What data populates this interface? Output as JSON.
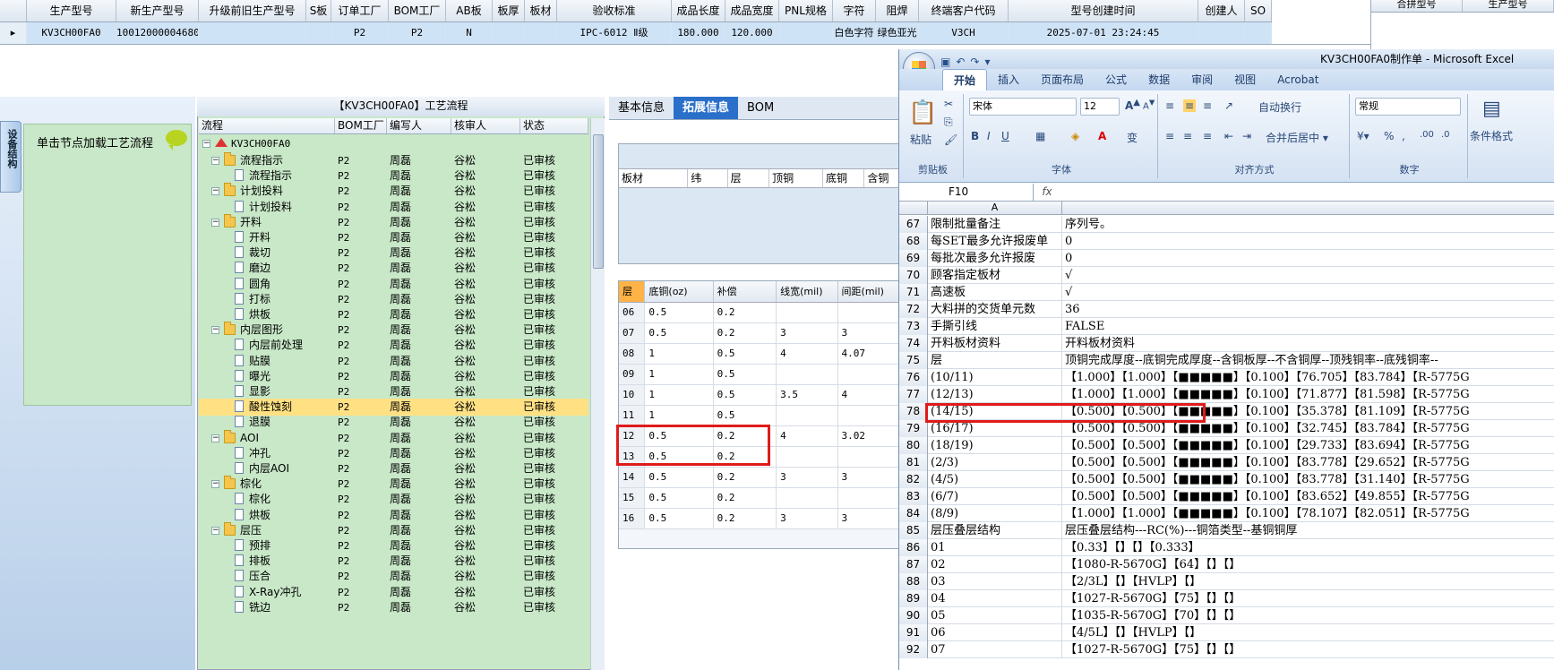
{
  "top_grid": {
    "headers": [
      "生产型号",
      "新生产型号",
      "升级前旧生产型号",
      "S板",
      "订单工厂",
      "BOM工厂",
      "AB板",
      "板厚",
      "板材",
      "验收标准",
      "成品长度",
      "成品宽度",
      "PNL规格",
      "字符",
      "阻焊",
      "终端客户代码",
      "型号创建时间",
      "创建人",
      "SO"
    ],
    "row": [
      "KV3CH00FA0",
      "10012000004680",
      "",
      "",
      "P2",
      "P2",
      "N",
      "",
      "",
      "IPC-6012 Ⅱ级",
      "180.000",
      "120.000",
      "",
      "白色字符",
      "绿色亚光",
      "V3CH",
      "2025-07-01 23:24:45",
      "",
      ""
    ],
    "row_indicator": "▸"
  },
  "merge_panel": {
    "headers": [
      "合拼型号",
      "生产型号"
    ]
  },
  "left_panel": {
    "vertical_tab": "设备结构",
    "load_label": "单击节点加载工艺流程"
  },
  "tree": {
    "title": "【KV3CH00FA0】工艺流程",
    "headers": [
      "流程",
      "BOM工厂",
      "编写人",
      "核审人",
      "状态"
    ],
    "root": "KV3CH00FA0",
    "rows": [
      {
        "label": "流程指示",
        "type": "folder",
        "level": 1,
        "bom": "P2",
        "writer": "周磊",
        "reviewer": "谷松",
        "status": "已审核"
      },
      {
        "label": "流程指示",
        "type": "file",
        "level": 2,
        "bom": "P2",
        "writer": "周磊",
        "reviewer": "谷松",
        "status": "已审核"
      },
      {
        "label": "计划投料",
        "type": "folder",
        "level": 1,
        "bom": "P2",
        "writer": "周磊",
        "reviewer": "谷松",
        "status": "已审核"
      },
      {
        "label": "计划投料",
        "type": "file",
        "level": 2,
        "bom": "P2",
        "writer": "周磊",
        "reviewer": "谷松",
        "status": "已审核"
      },
      {
        "label": "开料",
        "type": "folder",
        "level": 1,
        "bom": "P2",
        "writer": "周磊",
        "reviewer": "谷松",
        "status": "已审核"
      },
      {
        "label": "开料",
        "type": "file",
        "level": 2,
        "bom": "P2",
        "writer": "周磊",
        "reviewer": "谷松",
        "status": "已审核"
      },
      {
        "label": "裁切",
        "type": "file",
        "level": 2,
        "bom": "P2",
        "writer": "周磊",
        "reviewer": "谷松",
        "status": "已审核"
      },
      {
        "label": "磨边",
        "type": "file",
        "level": 2,
        "bom": "P2",
        "writer": "周磊",
        "reviewer": "谷松",
        "status": "已审核"
      },
      {
        "label": "圆角",
        "type": "file",
        "level": 2,
        "bom": "P2",
        "writer": "周磊",
        "reviewer": "谷松",
        "status": "已审核"
      },
      {
        "label": "打标",
        "type": "file",
        "level": 2,
        "bom": "P2",
        "writer": "周磊",
        "reviewer": "谷松",
        "status": "已审核"
      },
      {
        "label": "烘板",
        "type": "file",
        "level": 2,
        "bom": "P2",
        "writer": "周磊",
        "reviewer": "谷松",
        "status": "已审核"
      },
      {
        "label": "内层图形",
        "type": "folder",
        "level": 1,
        "bom": "P2",
        "writer": "周磊",
        "reviewer": "谷松",
        "status": "已审核"
      },
      {
        "label": "内层前处理",
        "type": "file",
        "level": 2,
        "bom": "P2",
        "writer": "周磊",
        "reviewer": "谷松",
        "status": "已审核"
      },
      {
        "label": "贴膜",
        "type": "file",
        "level": 2,
        "bom": "P2",
        "writer": "周磊",
        "reviewer": "谷松",
        "status": "已审核"
      },
      {
        "label": "曝光",
        "type": "file",
        "level": 2,
        "bom": "P2",
        "writer": "周磊",
        "reviewer": "谷松",
        "status": "已审核"
      },
      {
        "label": "显影",
        "type": "file",
        "level": 2,
        "bom": "P2",
        "writer": "周磊",
        "reviewer": "谷松",
        "status": "已审核"
      },
      {
        "label": "酸性蚀刻",
        "type": "file",
        "level": 2,
        "bom": "P2",
        "writer": "周磊",
        "reviewer": "谷松",
        "status": "已审核",
        "selected": true
      },
      {
        "label": "退膜",
        "type": "file",
        "level": 2,
        "bom": "P2",
        "writer": "周磊",
        "reviewer": "谷松",
        "status": "已审核"
      },
      {
        "label": "AOI",
        "type": "folder",
        "level": 1,
        "bom": "P2",
        "writer": "周磊",
        "reviewer": "谷松",
        "status": "已审核"
      },
      {
        "label": "冲孔",
        "type": "file",
        "level": 2,
        "bom": "P2",
        "writer": "周磊",
        "reviewer": "谷松",
        "status": "已审核"
      },
      {
        "label": "内层AOI",
        "type": "file",
        "level": 2,
        "bom": "P2",
        "writer": "周磊",
        "reviewer": "谷松",
        "status": "已审核"
      },
      {
        "label": "棕化",
        "type": "folder",
        "level": 1,
        "bom": "P2",
        "writer": "周磊",
        "reviewer": "谷松",
        "status": "已审核"
      },
      {
        "label": "棕化",
        "type": "file",
        "level": 2,
        "bom": "P2",
        "writer": "周磊",
        "reviewer": "谷松",
        "status": "已审核"
      },
      {
        "label": "烘板",
        "type": "file",
        "level": 2,
        "bom": "P2",
        "writer": "周磊",
        "reviewer": "谷松",
        "status": "已审核"
      },
      {
        "label": "层压",
        "type": "folder",
        "level": 1,
        "bom": "P2",
        "writer": "周磊",
        "reviewer": "谷松",
        "status": "已审核"
      },
      {
        "label": "预排",
        "type": "file",
        "level": 2,
        "bom": "P2",
        "writer": "周磊",
        "reviewer": "谷松",
        "status": "已审核"
      },
      {
        "label": "排板",
        "type": "file",
        "level": 2,
        "bom": "P2",
        "writer": "周磊",
        "reviewer": "谷松",
        "status": "已审核"
      },
      {
        "label": "压合",
        "type": "file",
        "level": 2,
        "bom": "P2",
        "writer": "周磊",
        "reviewer": "谷松",
        "status": "已审核"
      },
      {
        "label": "X-Ray冲孔",
        "type": "file",
        "level": 2,
        "bom": "P2",
        "writer": "周磊",
        "reviewer": "谷松",
        "status": "已审核"
      },
      {
        "label": "铣边",
        "type": "file",
        "level": 2,
        "bom": "P2",
        "writer": "周磊",
        "reviewer": "谷松",
        "status": "已审核"
      }
    ]
  },
  "mid_panel": {
    "tabs": [
      "基本信息",
      "拓展信息",
      "BOM"
    ],
    "active_tab": "拓展信息",
    "upper_headers": [
      "板材",
      "纬",
      "层",
      "顶铜",
      "底铜",
      "含铜"
    ],
    "lower_headers": [
      "层",
      "底铜(oz)",
      "补偿",
      "线宽(mil)",
      "间距(mil)"
    ],
    "lower_rows": [
      [
        "06",
        "0.5",
        "0.2",
        "",
        ""
      ],
      [
        "07",
        "0.5",
        "0.2",
        "3",
        "3"
      ],
      [
        "08",
        "1",
        "0.5",
        "4",
        "4.07"
      ],
      [
        "09",
        "1",
        "0.5",
        "",
        ""
      ],
      [
        "10",
        "1",
        "0.5",
        "3.5",
        "4"
      ],
      [
        "11",
        "1",
        "0.5",
        "",
        ""
      ],
      [
        "12",
        "0.5",
        "0.2",
        "4",
        "3.02"
      ],
      [
        "13",
        "0.5",
        "0.2",
        "",
        ""
      ],
      [
        "14",
        "0.5",
        "0.2",
        "3",
        "3"
      ],
      [
        "15",
        "0.5",
        "0.2",
        "",
        ""
      ],
      [
        "16",
        "0.5",
        "0.2",
        "3",
        "3"
      ]
    ]
  },
  "excel": {
    "title": "KV3CH00FA0制作单 - Microsoft Excel",
    "tabs": [
      "开始",
      "插入",
      "页面布局",
      "公式",
      "数据",
      "审阅",
      "视图",
      "Acrobat"
    ],
    "ribbon": {
      "paste": "粘贴",
      "clipboard": "剪贴板",
      "font_name": "宋体",
      "font_size": "12",
      "font_group": "字体",
      "wrap_text": "自动换行",
      "merge_center": "合并后居中",
      "align_group": "对齐方式",
      "number_format": "常规",
      "number_group": "数字",
      "cond_format": "条件格式"
    },
    "name_box": "F10",
    "fx": "fx",
    "col_a": "A",
    "rows": [
      {
        "n": "67",
        "a": "限制批量备注",
        "b": "序列号。"
      },
      {
        "n": "68",
        "a": "每SET最多允许报废单",
        "b": "0"
      },
      {
        "n": "69",
        "a": "每批次最多允许报废",
        "b": "0"
      },
      {
        "n": "70",
        "a": "顾客指定板材",
        "b": "√"
      },
      {
        "n": "71",
        "a": "高速板",
        "b": "√"
      },
      {
        "n": "72",
        "a": "大料拼的交货单元数",
        "b": "36"
      },
      {
        "n": "73",
        "a": "手撕引线",
        "b": "FALSE"
      },
      {
        "n": "74",
        "a": "开料板材资料",
        "b": "开料板材资料"
      },
      {
        "n": "75",
        "a": "层",
        "b": "顶铜完成厚度--底铜完成厚度--含铜板厚--不含铜厚--顶残铜率--底残铜率--"
      },
      {
        "n": "76",
        "a": "(10/11)",
        "b": "【1.000】【1.000】【■■■■■】【0.100】【76.705】【83.784】【R-5775G"
      },
      {
        "n": "77",
        "a": "(12/13)",
        "b": "【1.000】【1.000】【■■■■■】【0.100】【71.877】【81.598】【R-5775G"
      },
      {
        "n": "78",
        "a": "(14/15)",
        "b": "【0.500】【0.500】【■■■■■】【0.100】【35.378】【81.109】【R-5775G"
      },
      {
        "n": "79",
        "a": "(16/17)",
        "b": "【0.500】【0.500】【■■■■■】【0.100】【32.745】【83.784】【R-5775G"
      },
      {
        "n": "80",
        "a": "(18/19)",
        "b": "【0.500】【0.500】【■■■■■】【0.100】【29.733】【83.694】【R-5775G"
      },
      {
        "n": "81",
        "a": "(2/3)",
        "b": "【0.500】【0.500】【■■■■■】【0.100】【83.778】【29.652】【R-5775G"
      },
      {
        "n": "82",
        "a": "(4/5)",
        "b": "【0.500】【0.500】【■■■■■】【0.100】【83.778】【31.140】【R-5775G"
      },
      {
        "n": "83",
        "a": "(6/7)",
        "b": "【0.500】【0.500】【■■■■■】【0.100】【83.652】【49.855】【R-5775G"
      },
      {
        "n": "84",
        "a": "(8/9)",
        "b": "【1.000】【1.000】【■■■■■】【0.100】【78.107】【82.051】【R-5775G"
      },
      {
        "n": "85",
        "a": "层压叠层结构",
        "b": "层压叠层结构---RC(%)---铜箔类型--基铜铜厚"
      },
      {
        "n": "86",
        "a": "01",
        "b": "【0.33】【】【】【0.333】"
      },
      {
        "n": "87",
        "a": "02",
        "b": "【1080-R-5670G】【64】【】【】"
      },
      {
        "n": "88",
        "a": "03",
        "b": "【2/3L】【】【HVLP】【】"
      },
      {
        "n": "89",
        "a": "04",
        "b": "【1027-R-5670G】【75】【】【】"
      },
      {
        "n": "90",
        "a": "05",
        "b": "【1035-R-5670G】【70】【】【】"
      },
      {
        "n": "91",
        "a": "06",
        "b": "【4/5L】【】【HVLP】【】"
      },
      {
        "n": "92",
        "a": "07",
        "b": "【1027-R-5670G】【75】【】【】"
      }
    ]
  }
}
